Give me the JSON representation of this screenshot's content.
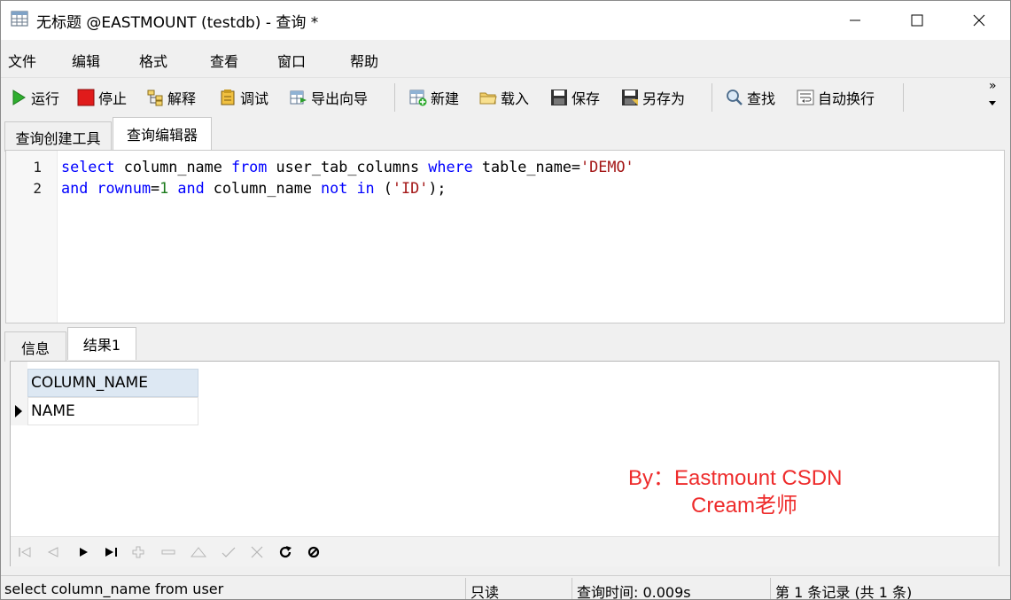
{
  "window": {
    "title": "无标题 @EASTMOUNT (testdb) - 查询 *"
  },
  "menu": [
    "文件",
    "编辑",
    "格式",
    "查看",
    "窗口",
    "帮助"
  ],
  "toolbar": {
    "run": "运行",
    "stop": "停止",
    "explain": "解释",
    "debug": "调试",
    "export_wizard": "导出向导",
    "new": "新建",
    "load": "载入",
    "save": "保存",
    "save_as": "另存为",
    "find": "查找",
    "word_wrap": "自动换行",
    "overflow": "»"
  },
  "tabs_top": [
    "查询创建工具",
    "查询编辑器"
  ],
  "editor": {
    "line_numbers": [
      "1",
      "2"
    ],
    "line1": {
      "t1": "select",
      "t2": " column_name ",
      "t3": "from",
      "t4": " user_tab_columns ",
      "t5": "where",
      "t6": " table_name=",
      "t7": "'DEMO'"
    },
    "line2": {
      "t1": "and",
      "t2": " ",
      "t3": "rownum",
      "t4": "=",
      "t5": "1",
      "t6": " ",
      "t7": "and",
      "t8": " column_name ",
      "t9": "not",
      "t10": " ",
      "t11": "in",
      "t12": " (",
      "t13": "'ID'",
      "t14": ");"
    }
  },
  "tabs_bottom": [
    "信息",
    "结果1"
  ],
  "result": {
    "columns": [
      "COLUMN_NAME"
    ],
    "rows": [
      [
        "NAME"
      ]
    ]
  },
  "watermark": {
    "line1": "By：Eastmount CSDN",
    "line2": "Cream老师"
  },
  "status": {
    "sql": "select column_name from user",
    "mode": "只读",
    "query_time": "查询时间: 0.009s",
    "records": "第 1 条记录 (共 1 条)"
  },
  "colors": {
    "keyword": "#0000ff",
    "string": "#a31515",
    "watermark": "#ee2c2c",
    "grid_header": "#dde8f3"
  }
}
